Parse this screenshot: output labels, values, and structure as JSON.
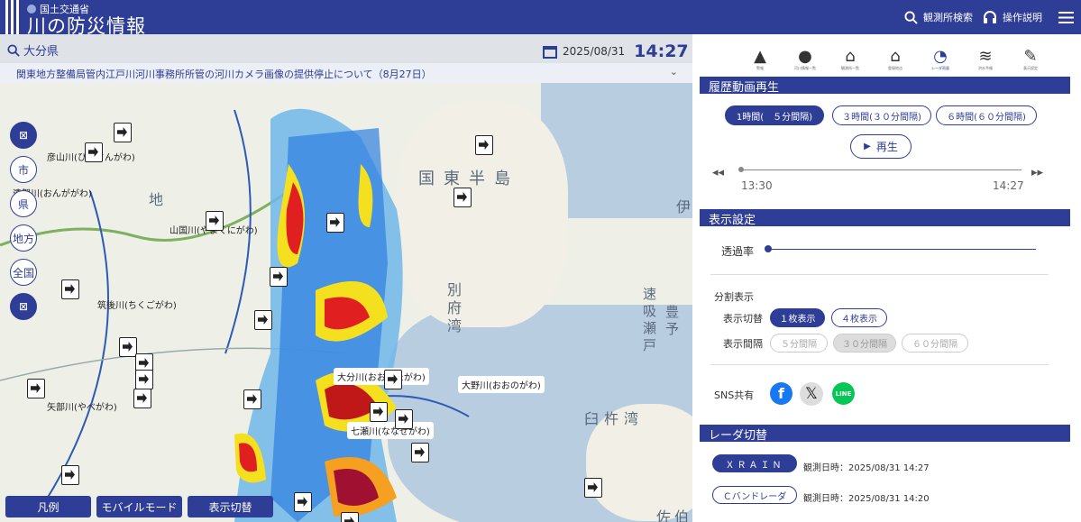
{
  "header": {
    "ministry": "国土交通省",
    "title": "川の防災情報",
    "search_label": "観測所検索",
    "help_label": "操作説明"
  },
  "mapbar": {
    "prefecture": "大分県",
    "date": "2025/08/31",
    "time": "14:27"
  },
  "notice": "関東地方整備局管内江戸川河川事務所所管の河川カメラ画像の提供停止について（8月27日）",
  "map_labels": {
    "r1": "彦山川(ひこさんがわ)",
    "r2": "遠賀川(おんががわ)",
    "r3": "山国川(やまくにがわ)",
    "r4": "筑後川(ちくごがわ)",
    "r5": "矢部川(やべがわ)",
    "r6": "大分川(おおいたがわ)",
    "r7": "大野川(おおのがわ)",
    "r8": "七瀬川(ななせがわ)",
    "place1": "国東半島",
    "place2": "別府湾",
    "place3": "臼杵湾",
    "place4": "佐伯",
    "place5": "速吸瀬戸",
    "place6": "豊予",
    "place7": "伊",
    "place8": "地"
  },
  "left_buttons": [
    "市",
    "県",
    "地方",
    "全国"
  ],
  "bottom_buttons": [
    "凡例",
    "モバイルモード",
    "表示切替"
  ],
  "panel": {
    "icon_tabs": [
      {
        "icon": "warning-icon",
        "label": "警報"
      },
      {
        "icon": "alert-icon",
        "label": "河川情報一覧"
      },
      {
        "icon": "house-list-icon",
        "label": "観測所一覧"
      },
      {
        "icon": "home-icon",
        "label": "登録地点"
      },
      {
        "icon": "radar-icon",
        "label": "レーダ雨量"
      },
      {
        "icon": "wave-icon",
        "label": "洪水予報"
      },
      {
        "icon": "wrench-icon",
        "label": "表示設定"
      }
    ],
    "history": {
      "title": "履歴動画再生",
      "options": [
        "1時間(　５分間隔)",
        "３時間(３０分間隔)",
        "６時間(６０分間隔)"
      ],
      "play": "再生",
      "start": "13:30",
      "end": "14:27"
    },
    "display": {
      "title": "表示設定",
      "opacity": "透過率",
      "split": "分割表示",
      "switch_label": "表示切替",
      "switch_options": [
        "１枚表示",
        "４枚表示"
      ],
      "interval_label": "表示間隔",
      "interval_options": [
        "５分間隔",
        "３０分間隔",
        "６０分間隔"
      ],
      "sns": "SNS共有"
    },
    "radar": {
      "title": "レーダ切替",
      "rows": [
        {
          "name": "ＸＲＡＩＮ",
          "time": "観測日時：2025/08/31 14:27"
        },
        {
          "name": "Ｃバンドレーダ",
          "time": "観測日時：2025/08/31 14:20"
        }
      ]
    }
  },
  "colors": {
    "brand": "#2e3d95"
  }
}
